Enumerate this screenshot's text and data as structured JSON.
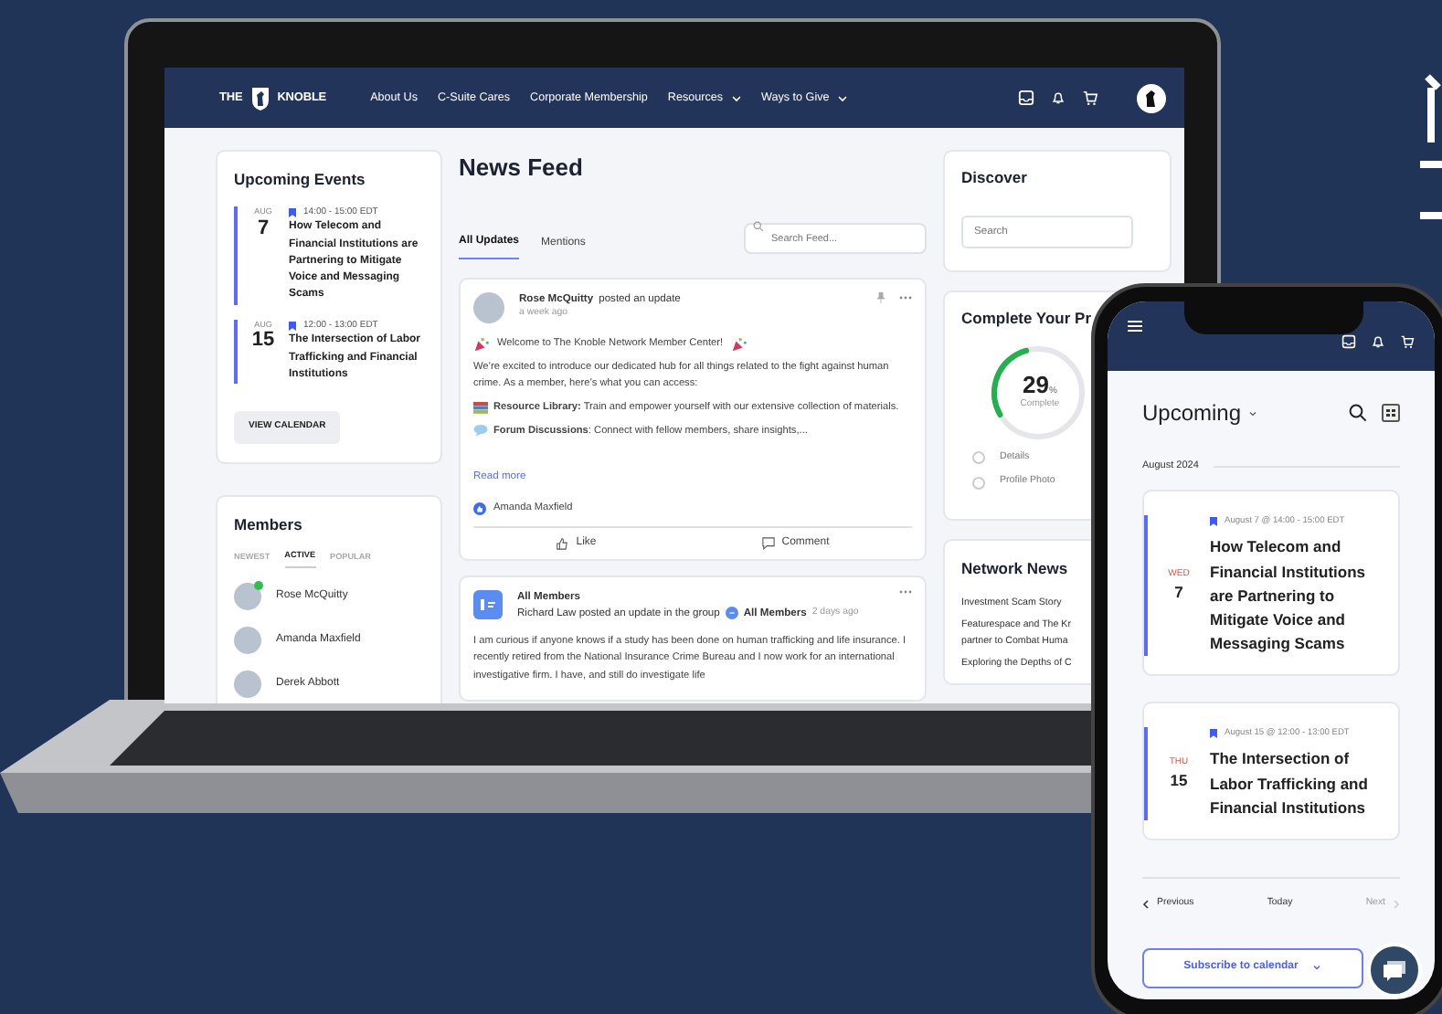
{
  "laptop": {
    "nav": {
      "logo_left": "THE",
      "logo_right": "KNOBLE",
      "links": [
        {
          "label": "About Us",
          "dropdown": false
        },
        {
          "label": "C-Suite Cares",
          "dropdown": false
        },
        {
          "label": "Corporate Membership",
          "dropdown": false
        },
        {
          "label": "Resources",
          "dropdown": true
        },
        {
          "label": "Ways to Give",
          "dropdown": true
        }
      ]
    },
    "upcoming_events": {
      "title": "Upcoming Events",
      "events": [
        {
          "month": "AUG",
          "day": "7",
          "time": "14:00 - 15:00 EDT",
          "title": "How Telecom and Financial Institutions are Partnering to Mitigate Voice and Messaging Scams"
        },
        {
          "month": "AUG",
          "day": "15",
          "time": "12:00 - 13:00 EDT",
          "title": "The Intersection of Labor Trafficking and Financial Institutions"
        }
      ],
      "button": "VIEW CALENDAR"
    },
    "members": {
      "title": "Members",
      "tabs": [
        {
          "label": "NEWEST",
          "selected": false
        },
        {
          "label": "ACTIVE",
          "selected": true
        },
        {
          "label": "POPULAR",
          "selected": false
        }
      ],
      "people": [
        {
          "name": "Rose McQuitty",
          "online": true
        },
        {
          "name": "Amanda Maxfield",
          "online": false
        },
        {
          "name": "Derek Abbott",
          "online": false
        }
      ]
    },
    "news_feed": {
      "title": "News Feed",
      "tabs": [
        {
          "label": "All Updates",
          "selected": true
        },
        {
          "label": "Mentions",
          "selected": false
        }
      ],
      "search": {
        "placeholder": "Search Feed..."
      },
      "posts": [
        {
          "kind": "member",
          "author": "Rose McQuitty",
          "action": "posted an update",
          "time": "a week ago",
          "headline": "Welcome to The Knoble Network Member Center!",
          "paragraphs": [
            "We’re excited to introduce our dedicated hub for all things related to the fight against human crime. As a member, here’s what you can access:",
            "**Resource Library:** Train and empower yourself with our extensive collection of materials.",
            "**Forum Discussions**: Connect with fellow members, share insights,..."
          ],
          "read_more": "Read more",
          "liked_by": "Amanda Maxfield",
          "actions": [
            "Like",
            "Comment"
          ]
        },
        {
          "kind": "group",
          "group": "All Members",
          "author": "Richard Law",
          "action": "posted an update in the group",
          "group_chip": "All Members",
          "time": "2 days ago",
          "paragraphs": [
            "I am curious if anyone knows if a study has been done on human trafficking and life insurance. I recently retired from the National Insurance Crime Bureau and I now work for an international investigative firm. I have, and still do investigate life"
          ]
        }
      ]
    },
    "discover": {
      "title": "Discover",
      "search": {
        "placeholder": "Search"
      }
    },
    "profile": {
      "title": "Complete Your Pr",
      "level": 0.29,
      "percent": "29",
      "unit": "%",
      "caption": "Complete",
      "steps": [
        {
          "label": "Details",
          "done": false
        },
        {
          "label": "Profile Photo",
          "done": false
        }
      ]
    },
    "network_news": {
      "title": "Network News",
      "items": [
        "Investment Scam Story",
        "Featurespace and The Kr\npartner to Combat Huma",
        "Exploring the Depths of C"
      ]
    }
  },
  "phone": {
    "heading": "Upcoming",
    "month": "August 2024",
    "events": [
      {
        "date": "August 7 @ 14:00 - 15:00 EDT",
        "weekday": "WED",
        "day": "7",
        "title": "How Telecom and Financial Institutions are Partnering to Mitigate Voice and Messaging Scams"
      },
      {
        "date": "August 15 @ 12:00 - 13:00 EDT",
        "weekday": "THU",
        "day": "15",
        "title": "The Intersection of Labor Trafficking and Financial Institutions"
      }
    ],
    "pager": [
      {
        "label": "Previous",
        "kind": "prev",
        "disabled": false
      },
      {
        "label": "Today",
        "kind": "today",
        "disabled": false
      },
      {
        "label": "Next",
        "kind": "next",
        "disabled": true
      }
    ],
    "subscribe": "Subscribe to calendar"
  }
}
